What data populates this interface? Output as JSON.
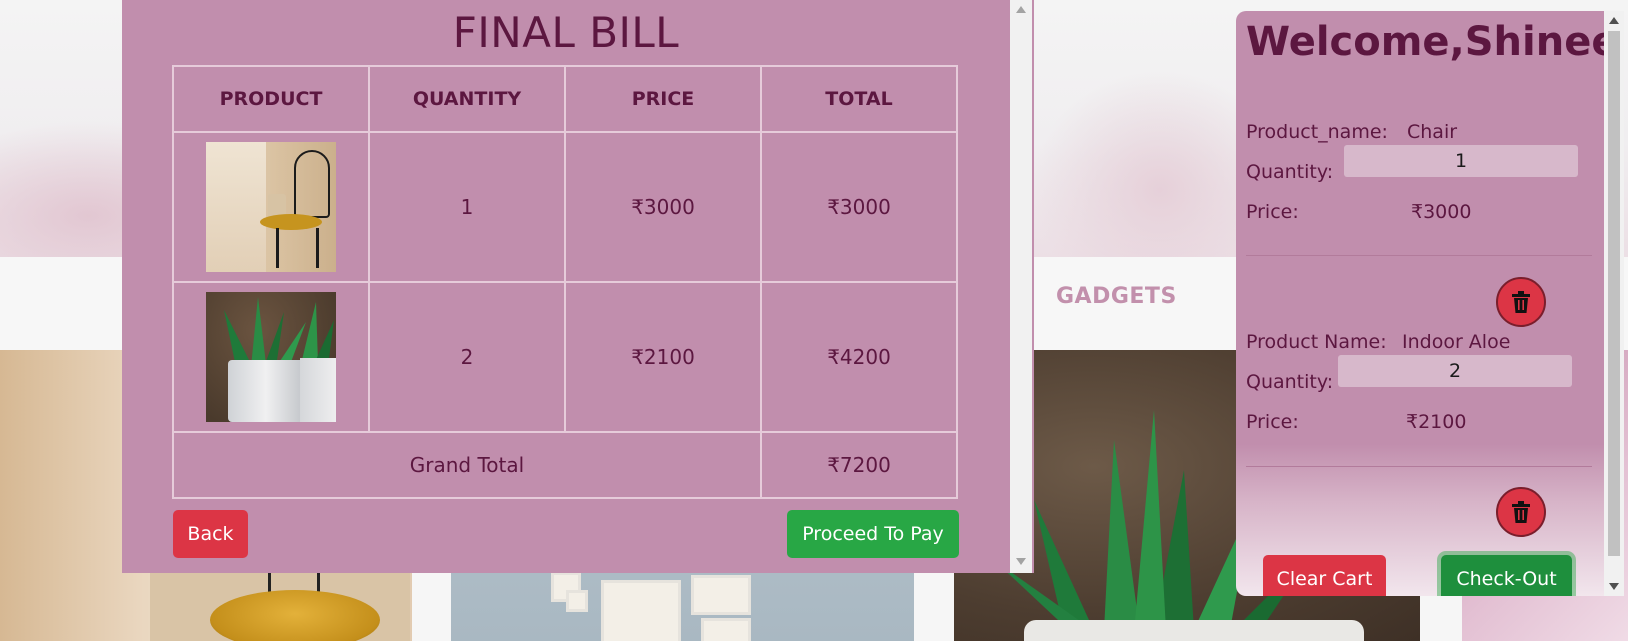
{
  "background": {
    "nav_link_gadgets": "GADGETS"
  },
  "bill": {
    "title": "FINAL BILL",
    "columns": [
      "PRODUCT",
      "QUANTITY",
      "PRICE",
      "TOTAL"
    ],
    "rows": [
      {
        "product_image": "chair-photo",
        "quantity": "1",
        "price": "₹3000",
        "total": "₹3000"
      },
      {
        "product_image": "indoor-aloe-photo",
        "quantity": "2",
        "price": "₹2100",
        "total": "₹4200"
      }
    ],
    "grand_total_label": "Grand Total",
    "grand_total_value": "₹7200",
    "back_label": "Back",
    "pay_label": "Proceed To Pay"
  },
  "cart": {
    "welcome": "Welcome,Shinee",
    "items": [
      {
        "name_label": "Product_name:",
        "name": "Chair",
        "qty_label": "Quantity:",
        "qty": "1",
        "price_label": "Price:",
        "price": "₹3000"
      },
      {
        "name_label": "Product Name:",
        "name": "Indoor Aloe",
        "qty_label": "Quantity:",
        "qty": "2",
        "price_label": "Price:",
        "price": "₹2100"
      }
    ],
    "clear_label": "Clear Cart",
    "checkout_label": "Check-Out"
  },
  "colors": {
    "panel": "#c18ead",
    "text": "#5c1740",
    "danger": "#dc3545",
    "success": "#28a745"
  },
  "icons": [
    "trash-icon",
    "scroll-up-arrow-icon",
    "scroll-down-arrow-icon"
  ]
}
